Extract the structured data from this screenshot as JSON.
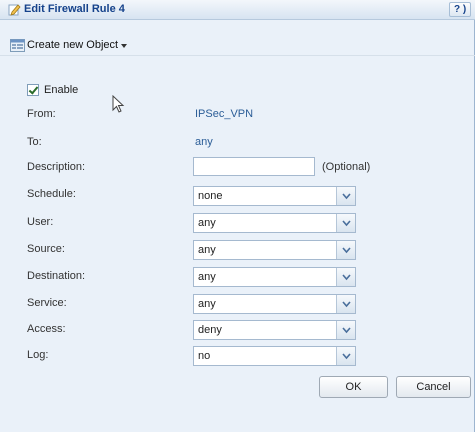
{
  "window": {
    "title": "Edit Firewall Rule 4",
    "help_label": "? )"
  },
  "toolbar": {
    "create_label": "Create new Object"
  },
  "form": {
    "enable_label": "Enable",
    "enable_checked": true,
    "from_label": "From:",
    "from_value": "IPSec_VPN",
    "to_label": "To:",
    "to_value": "any",
    "description_label": "Description:",
    "description_value": "",
    "optional_label": "(Optional)",
    "schedule_label": "Schedule:",
    "schedule_value": "none",
    "user_label": "User:",
    "user_value": "any",
    "source_label": "Source:",
    "source_value": "any",
    "destination_label": "Destination:",
    "destination_value": "any",
    "service_label": "Service:",
    "service_value": "any",
    "access_label": "Access:",
    "access_value": "deny",
    "log_label": "Log:",
    "log_value": "no"
  },
  "footer": {
    "ok_label": "OK",
    "cancel_label": "Cancel"
  }
}
